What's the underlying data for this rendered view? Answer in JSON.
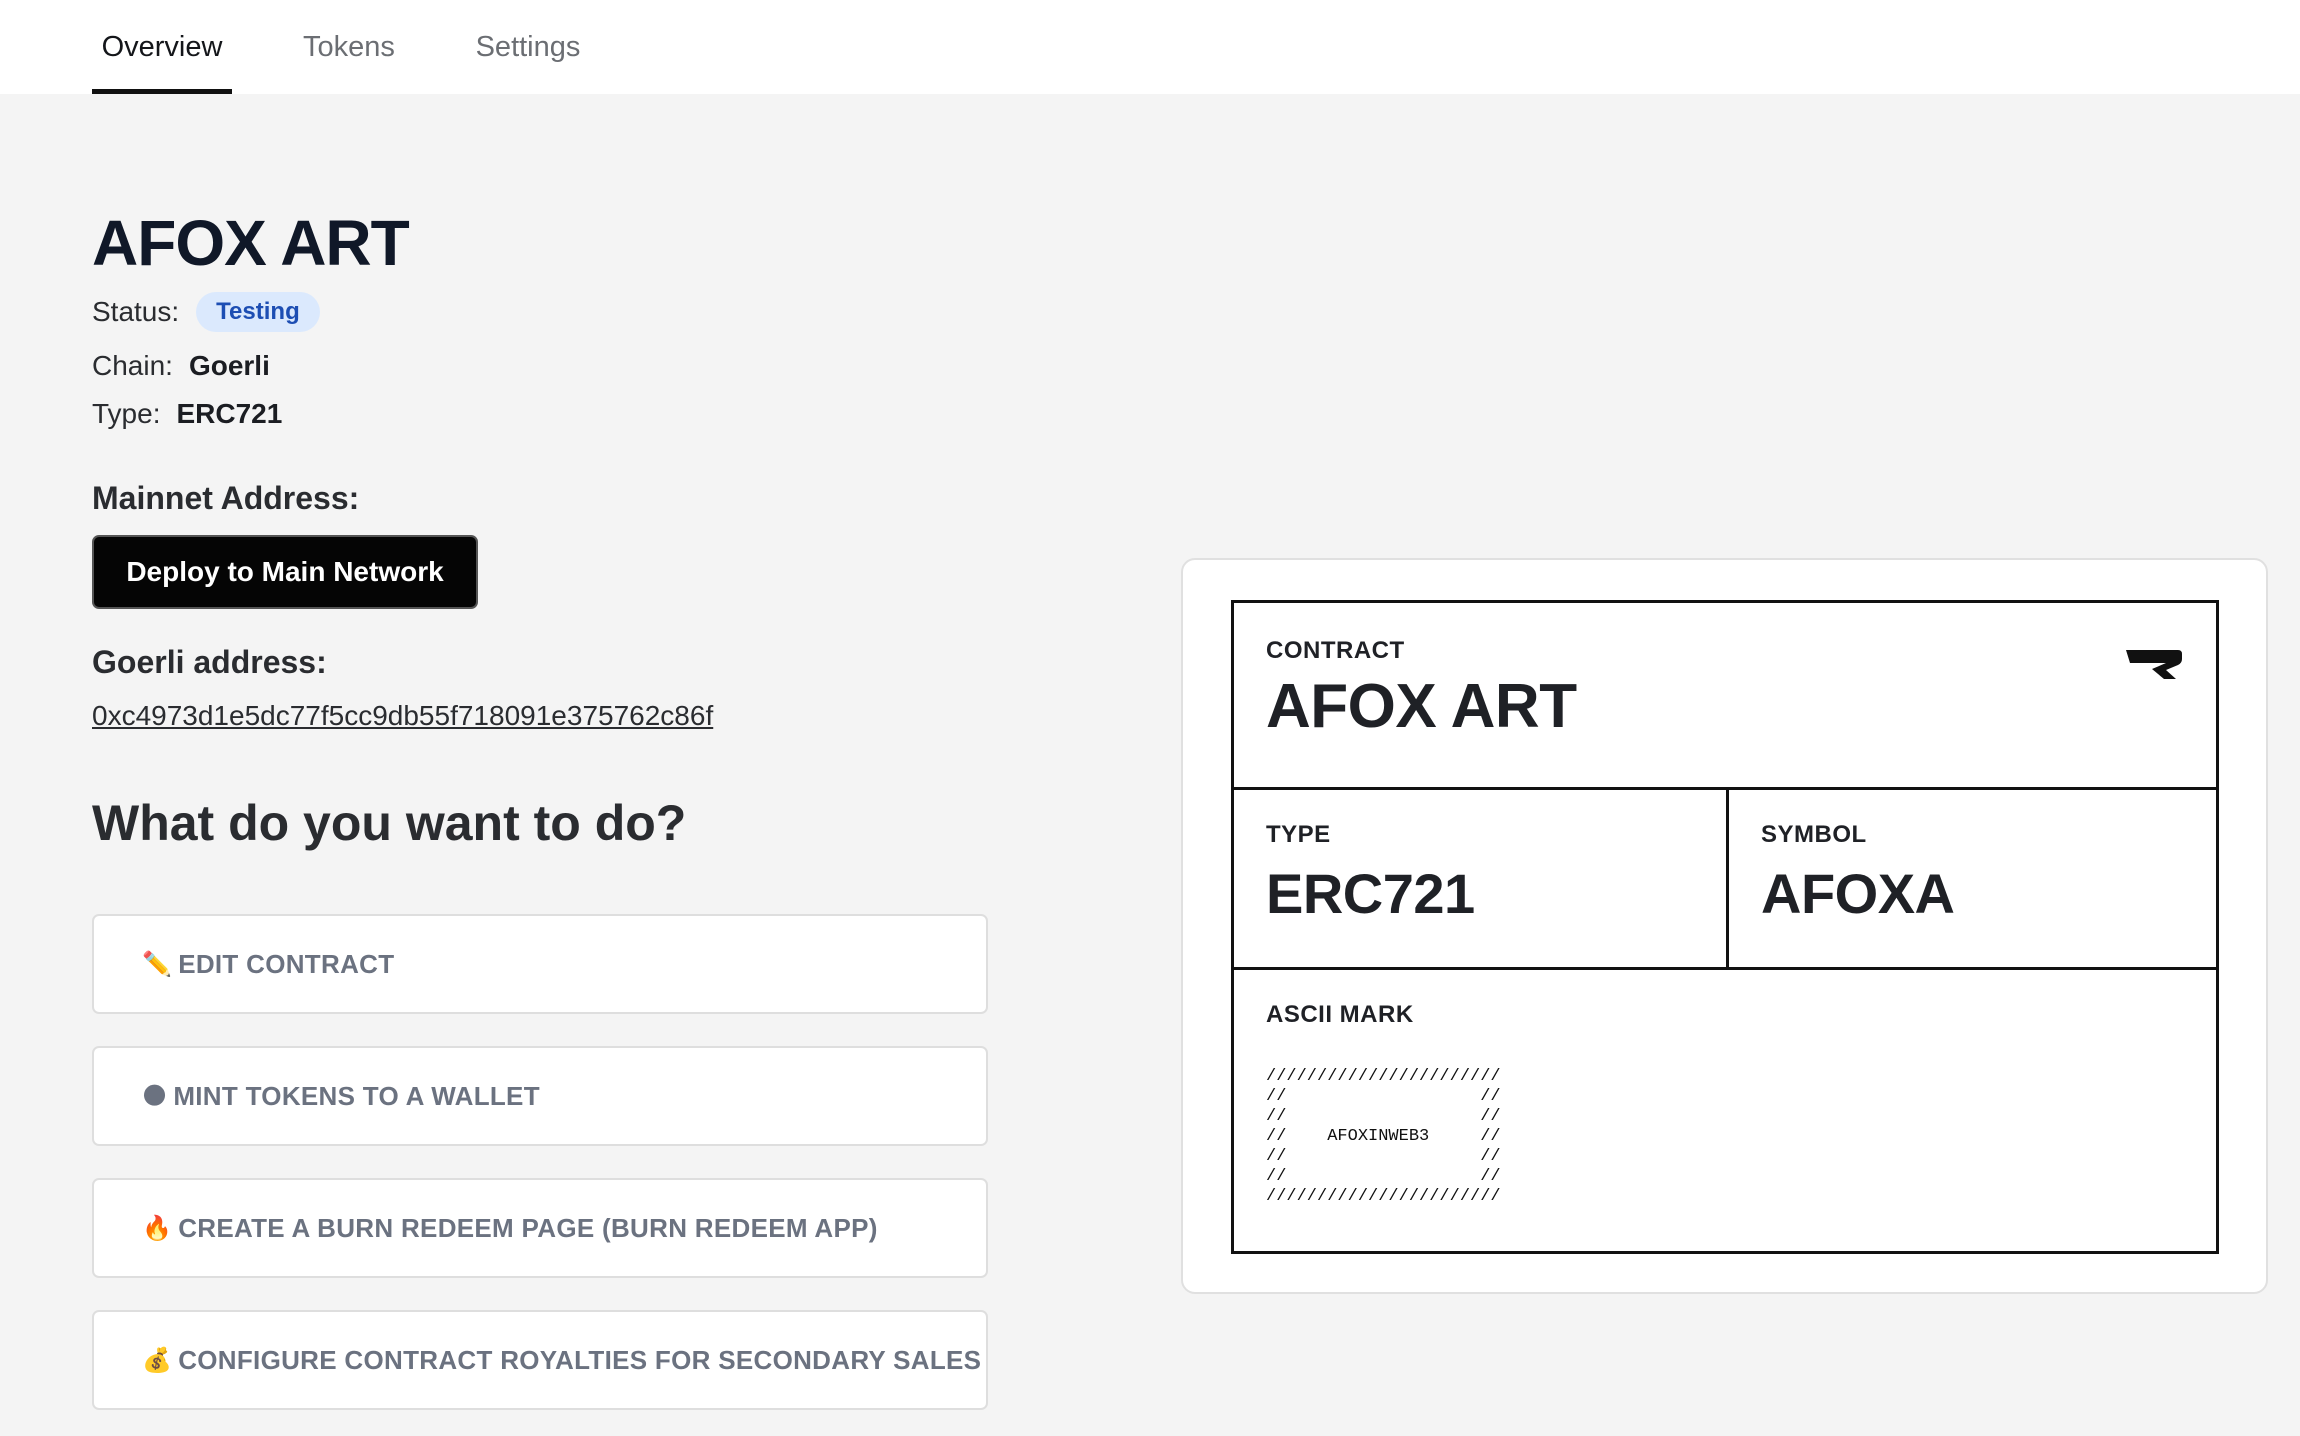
{
  "tabs": [
    {
      "label": "Overview",
      "active": true
    },
    {
      "label": "Tokens",
      "active": false
    },
    {
      "label": "Settings",
      "active": false
    }
  ],
  "contract": {
    "name": "AFOX ART",
    "status_label": "Status:",
    "status_value": "Testing",
    "chain_label": "Chain:",
    "chain_value": "Goerli",
    "type_label": "Type:",
    "type_value": "ERC721"
  },
  "mainnet": {
    "label": "Mainnet Address:",
    "deploy_button": "Deploy to Main Network"
  },
  "goerli": {
    "label": "Goerli address:",
    "address": "0xc4973d1e5dc77f5cc9db55f718091e375762c86f"
  },
  "actions": {
    "heading": "What do you want to do?",
    "items": [
      {
        "emoji": "✏️",
        "label": "EDIT CONTRACT"
      },
      {
        "emoji": "🌑",
        "label": "MINT TOKENS TO A WALLET"
      },
      {
        "emoji": "🔥",
        "label": "CREATE A BURN REDEEM PAGE (BURN REDEEM APP)"
      },
      {
        "emoji": "💰",
        "label": "CONFIGURE CONTRACT ROYALTIES FOR SECONDARY SALES"
      }
    ]
  },
  "card": {
    "contract_label": "CONTRACT",
    "contract_name": "AFOX ART",
    "type_label": "TYPE",
    "type_value": "ERC721",
    "symbol_label": "SYMBOL",
    "symbol_value": "AFOXA",
    "ascii_label": "ASCII MARK",
    "ascii_mark": "///////////////////////\n//                   //\n//                   //\n//    AFOXINWEB3     //\n//                   //\n//                   //\n///////////////////////"
  },
  "colors": {
    "background": "#f4f4f4",
    "badge_bg": "#dbe9fd",
    "badge_text": "#1d4eb3",
    "primary_button": "#050505"
  }
}
